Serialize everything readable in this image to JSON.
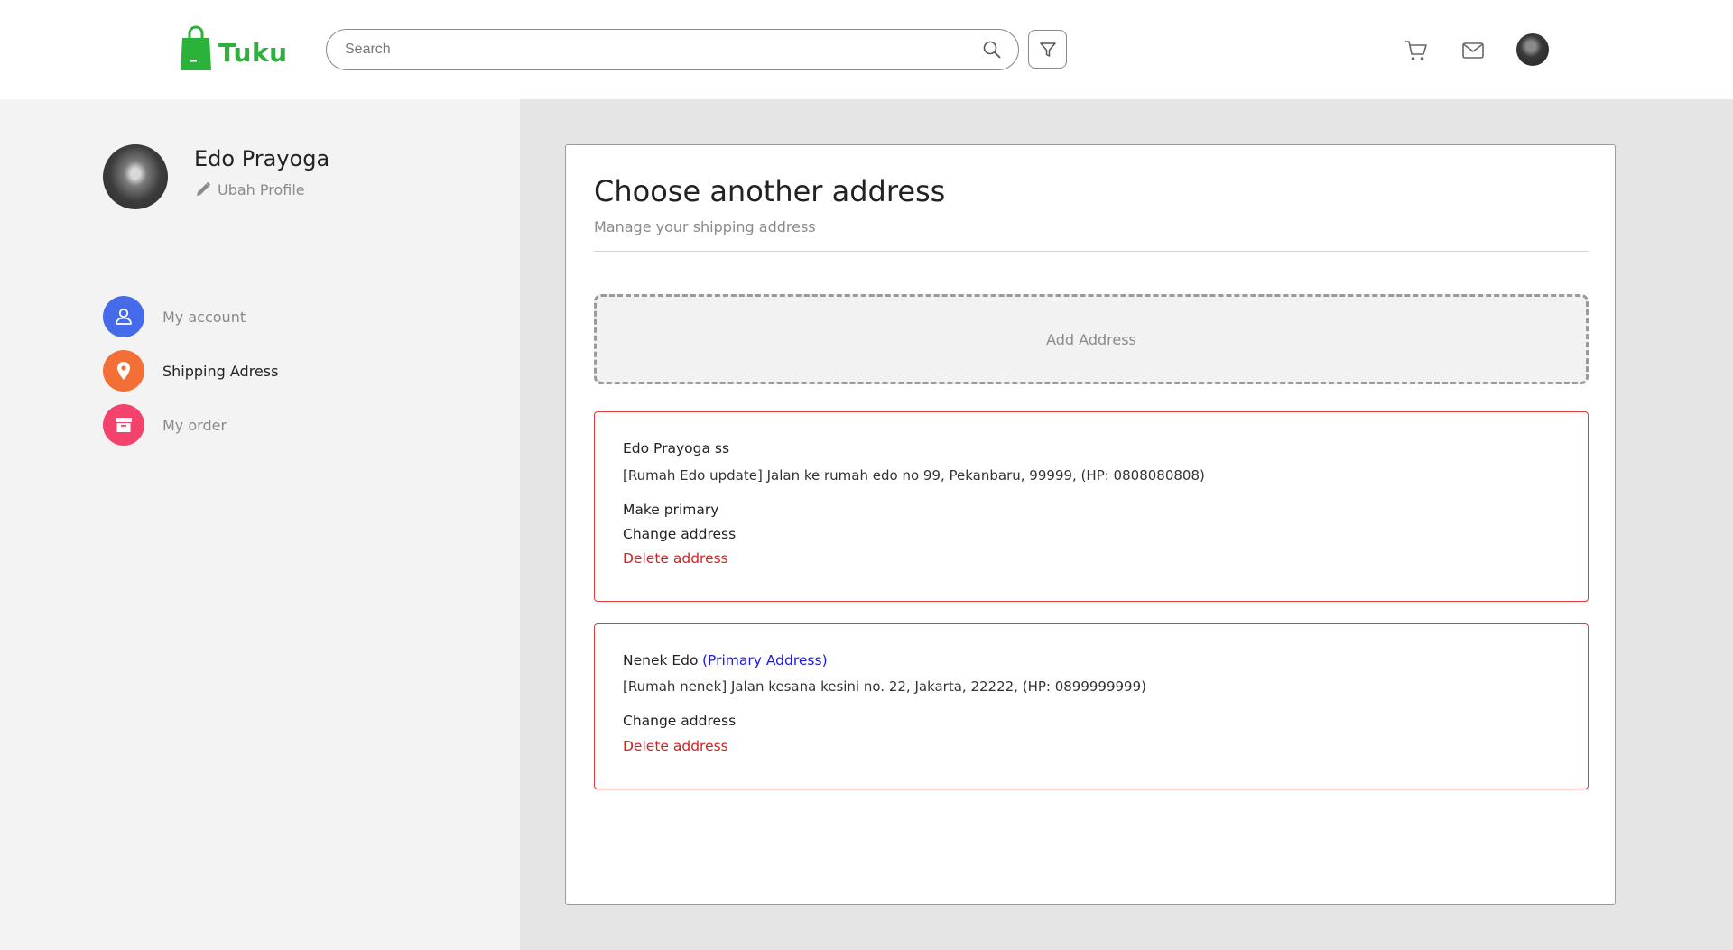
{
  "header": {
    "brand": "Tuku",
    "search_placeholder": "Search"
  },
  "sidebar": {
    "user_name": "Edo Prayoga",
    "edit_profile": "Ubah Profile",
    "nav": [
      {
        "label": "My account",
        "icon": "user-icon",
        "color": "#456bea",
        "active": false
      },
      {
        "label": "Shipping Adress",
        "icon": "location-pin-icon",
        "color": "#f36f35",
        "active": true
      },
      {
        "label": "My order",
        "icon": "archive-box-icon",
        "color": "#f3436c",
        "active": false
      }
    ]
  },
  "main": {
    "title": "Choose another address",
    "subtitle": "Manage your shipping address",
    "add_address": "Add Address",
    "addresses": [
      {
        "name": "Edo Prayoga ss",
        "primary_tag": "",
        "detail": "[Rumah Edo update] Jalan ke rumah edo no 99, Pekanbaru, 99999, (HP: 0808080808)",
        "make_primary": "Make primary",
        "change": "Change address",
        "delete": "Delete address"
      },
      {
        "name": "Nenek Edo",
        "primary_tag": "(Primary Address)",
        "detail": "[Rumah nenek] Jalan kesana kesini no. 22, Jakarta, 22222, (HP: 0899999999)",
        "change": "Change address",
        "delete": "Delete address"
      }
    ]
  },
  "colors": {
    "brand": "#2ab23a",
    "address_border": "#e03a3a",
    "delete": "#d81e1e",
    "primary_tag": "#1a1ae6"
  }
}
